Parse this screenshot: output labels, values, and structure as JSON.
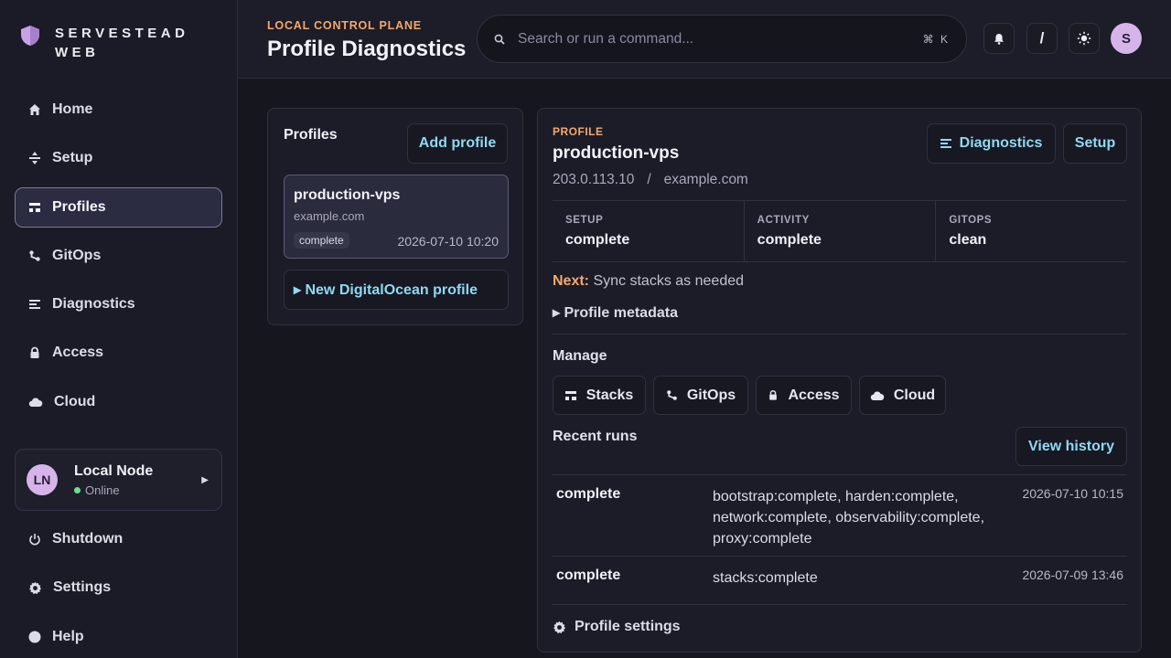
{
  "app": {
    "brand": "SERVESTEAD WEB"
  },
  "sidebar": {
    "items": [
      {
        "label": "Home",
        "icon": "home-icon"
      },
      {
        "label": "Setup",
        "icon": "setup-icon"
      },
      {
        "label": "Profiles",
        "icon": "profiles-icon",
        "active": true
      },
      {
        "label": "GitOps",
        "icon": "gitops-icon"
      },
      {
        "label": "Diagnostics",
        "icon": "diagnostics-icon"
      },
      {
        "label": "Access",
        "icon": "lock-icon"
      },
      {
        "label": "Cloud",
        "icon": "cloud-icon"
      }
    ],
    "node": {
      "initials": "LN",
      "name": "Local Node",
      "status": "Online"
    },
    "bottom_items": [
      {
        "label": "Shutdown",
        "icon": "power-icon"
      },
      {
        "label": "Settings",
        "icon": "gear-icon"
      },
      {
        "label": "Help",
        "icon": "help-icon"
      }
    ]
  },
  "header": {
    "eyebrow": "LOCAL CONTROL PLANE",
    "title": "Profile Diagnostics",
    "search_placeholder": "Search or run a command...",
    "shortcut": "⌘ K",
    "slash_label": "/",
    "user_initial": "S"
  },
  "profiles_panel": {
    "title": "Profiles",
    "add_label": "Add profile",
    "items": [
      {
        "name": "production-vps",
        "host": "example.com",
        "status": "complete",
        "date": "2026-07-10 10:20"
      }
    ],
    "new_label": "▸ New DigitalOcean profile"
  },
  "detail": {
    "eyebrow": "PROFILE",
    "name": "production-vps",
    "ip": "203.0.113.10",
    "separator": "/",
    "host": "example.com",
    "diagnostics_label": "Diagnostics",
    "setup_label": "Setup",
    "stats": [
      {
        "label": "SETUP",
        "value": "complete"
      },
      {
        "label": "ACTIVITY",
        "value": "complete"
      },
      {
        "label": "GITOPS",
        "value": "clean"
      }
    ],
    "next_label": "Next:",
    "next_text": "Sync stacks as needed",
    "metadata_label": "▸ Profile metadata",
    "manage_title": "Manage",
    "manage_buttons": [
      {
        "label": "Stacks",
        "icon": "stacks-icon"
      },
      {
        "label": "GitOps",
        "icon": "gitops-icon"
      },
      {
        "label": "Access",
        "icon": "lock-icon"
      },
      {
        "label": "Cloud",
        "icon": "cloud-icon"
      }
    ],
    "runs_title": "Recent runs",
    "history_label": "View history",
    "runs": [
      {
        "status": "complete",
        "steps": "bootstrap:complete, harden:complete, network:complete, observability:complete, proxy:complete",
        "time": "2026-07-10 10:15"
      },
      {
        "status": "complete",
        "steps": "stacks:complete",
        "time": "2026-07-09 13:46"
      }
    ],
    "settings_label": "Profile settings"
  },
  "colors": {
    "accent": "#8fd9f2",
    "eyebrow": "#f5a86b",
    "online": "#6ee08d",
    "avatar": "#d6b4ea"
  }
}
